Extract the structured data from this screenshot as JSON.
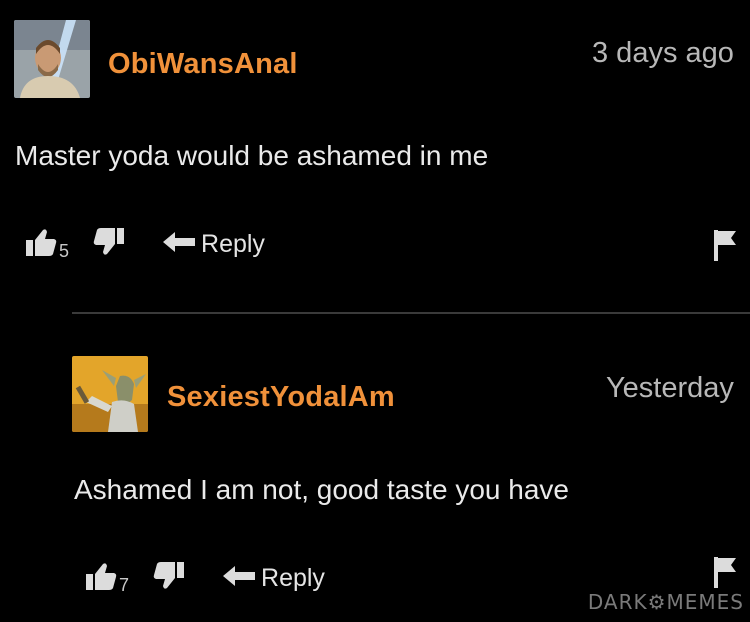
{
  "comments": [
    {
      "username": "ObiWansAnal",
      "timestamp": "3 days ago",
      "text": "Master yoda would be ashamed in me",
      "likes": "5",
      "reply_label": "Reply"
    },
    {
      "username": "SexiestYodalAm",
      "timestamp": "Yesterday",
      "text": "Ashamed I am not, good taste you have",
      "likes": "7",
      "reply_label": "Reply"
    }
  ],
  "watermark": "DARK⚙MEMES",
  "colors": {
    "username": "#f0913a",
    "background": "#000000",
    "text": "#eaeaea",
    "icon": "#dcdcdc"
  },
  "icons": {
    "like": "thumbs-up-icon",
    "dislike": "thumbs-down-icon",
    "reply": "reply-arrow-icon",
    "flag": "flag-icon"
  }
}
